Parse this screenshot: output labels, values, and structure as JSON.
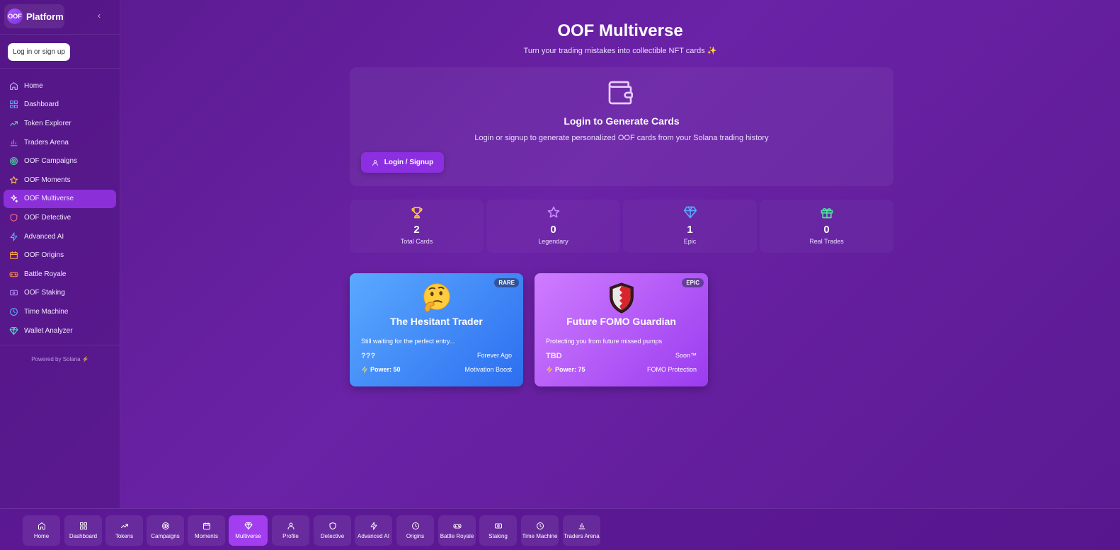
{
  "brand": {
    "logo_text": "OOF",
    "name": "Platform"
  },
  "sidebar": {
    "collapse_icon": "chevron-left-icon",
    "login_label": "Log in or sign up",
    "items": [
      {
        "label": "Home",
        "icon": "home-icon",
        "color": "#c9b3ff"
      },
      {
        "label": "Dashboard",
        "icon": "grid-icon",
        "color": "#6aa8ff"
      },
      {
        "label": "Token Explorer",
        "icon": "trending-up-icon",
        "color": "#4ee0a0"
      },
      {
        "label": "Traders Arena",
        "icon": "bar-chart-icon",
        "color": "#a080ff"
      },
      {
        "label": "OOF Campaigns",
        "icon": "target-icon",
        "color": "#4ee0a0"
      },
      {
        "label": "OOF Moments",
        "icon": "star-icon",
        "color": "#ffc24a"
      },
      {
        "label": "OOF Multiverse",
        "icon": "sparkles-icon",
        "color": "#ffffff",
        "active": true
      },
      {
        "label": "OOF Detective",
        "icon": "shield-icon",
        "color": "#ff6a8a"
      },
      {
        "label": "Advanced AI",
        "icon": "zap-icon",
        "color": "#58b6ff"
      },
      {
        "label": "OOF Origins",
        "icon": "calendar-icon",
        "color": "#ffa64a"
      },
      {
        "label": "Battle Royale",
        "icon": "gamepad-icon",
        "color": "#ff8a5a"
      },
      {
        "label": "OOF Staking",
        "icon": "coins-icon",
        "color": "#b08aff"
      },
      {
        "label": "Time Machine",
        "icon": "clock-icon",
        "color": "#58b6ff"
      },
      {
        "label": "Wallet Analyzer",
        "icon": "gem-icon",
        "color": "#4ee0c0"
      }
    ],
    "powered_by": "Powered by Solana ⚡"
  },
  "main": {
    "title": "OOF Multiverse",
    "subtitle": "Turn your trading mistakes into collectible NFT cards ✨",
    "login_card": {
      "icon": "wallet-icon",
      "title": "Login to Generate Cards",
      "description": "Login or signup to generate personalized OOF cards from your Solana trading history",
      "button_label": "Login / Signup",
      "button_icon": "user-icon"
    },
    "stats": [
      {
        "value": "2",
        "label": "Total Cards",
        "icon": "trophy-icon",
        "color": "#ffc24a"
      },
      {
        "value": "0",
        "label": "Legendary",
        "icon": "star-icon",
        "color": "#c58aff"
      },
      {
        "value": "1",
        "label": "Epic",
        "icon": "gem-icon",
        "color": "#58a6ff"
      },
      {
        "value": "0",
        "label": "Real Trades",
        "icon": "gift-icon",
        "color": "#4ee0a0"
      }
    ],
    "cards": [
      {
        "rarity": "RARE",
        "emoji": "thinking-face",
        "title": "The Hesitant Trader",
        "description": "Still waiting for the perfect entry...",
        "left_value": "???",
        "right_value": "Forever Ago",
        "power": "Power: 50",
        "ability": "Motivation Boost"
      },
      {
        "rarity": "EPIC",
        "emoji": "shield-crest",
        "title": "Future FOMO Guardian",
        "description": "Protecting you from future missed pumps",
        "left_value": "TBD",
        "right_value": "Soon™",
        "power": "Power: 75",
        "ability": "FOMO Protection"
      }
    ]
  },
  "bottom_nav": [
    {
      "label": "Home",
      "icon": "home-icon"
    },
    {
      "label": "Dashboard",
      "icon": "grid-icon"
    },
    {
      "label": "Tokens",
      "icon": "trending-up-icon"
    },
    {
      "label": "Campaigns",
      "icon": "target-icon"
    },
    {
      "label": "Moments",
      "icon": "calendar-icon"
    },
    {
      "label": "Multiverse",
      "icon": "gem-icon",
      "active": true
    },
    {
      "label": "Profile",
      "icon": "user-icon"
    },
    {
      "label": "Detective",
      "icon": "shield-icon"
    },
    {
      "label": "Advanced AI",
      "icon": "zap-icon"
    },
    {
      "label": "Origins",
      "icon": "clock-icon"
    },
    {
      "label": "Battle Royale",
      "icon": "gamepad-icon"
    },
    {
      "label": "Staking",
      "icon": "coins-icon"
    },
    {
      "label": "Time Machine",
      "icon": "clock-icon"
    },
    {
      "label": "Traders Arena",
      "icon": "bar-chart-icon"
    }
  ]
}
